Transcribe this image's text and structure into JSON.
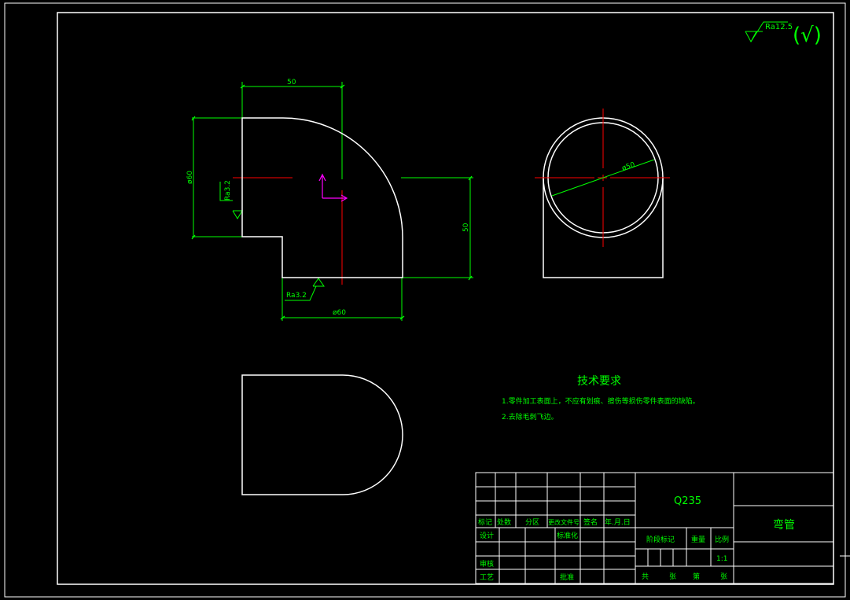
{
  "colors": {
    "background": "#000000",
    "outline": "#ffffff",
    "dimension": "#00ff00",
    "centerline": "#ff0000",
    "ucs": "#ff00ff",
    "text": "#00ff00",
    "text_white": "#ffffff"
  },
  "surface_finish": {
    "general_value": "Ra12.5",
    "check_mark": "(√)"
  },
  "front_view": {
    "dim_width_top": "50",
    "dim_diameter_left": "ø60",
    "dim_height_right": "50",
    "dim_diameter_bottom": "ø60",
    "roughness_left": "Ra3.2",
    "roughness_bottom": "Ra3.2"
  },
  "side_view": {
    "dim_diameter": "ø50"
  },
  "technical_requirements": {
    "title": "技术要求",
    "items": [
      "1.零件加工表面上，不应有划痕、擦伤等损伤零件表面的缺陷。",
      "2.去除毛刺飞边。"
    ]
  },
  "title_block": {
    "material": "Q235",
    "part_name": "弯管",
    "rev_headers": [
      "标记",
      "处数",
      "分区",
      "更改文件号",
      "签名",
      "年.月.日"
    ],
    "design": "设计",
    "standardization": "标准化",
    "review": "审核",
    "process": "工艺",
    "approve": "批准",
    "stage_mark": "阶段标记",
    "weight": "重量",
    "scale": "比例",
    "scale_value": "1:1",
    "total": "共",
    "sheet_unit1": "张",
    "sheet_label": "第",
    "sheet_unit2": "张"
  }
}
